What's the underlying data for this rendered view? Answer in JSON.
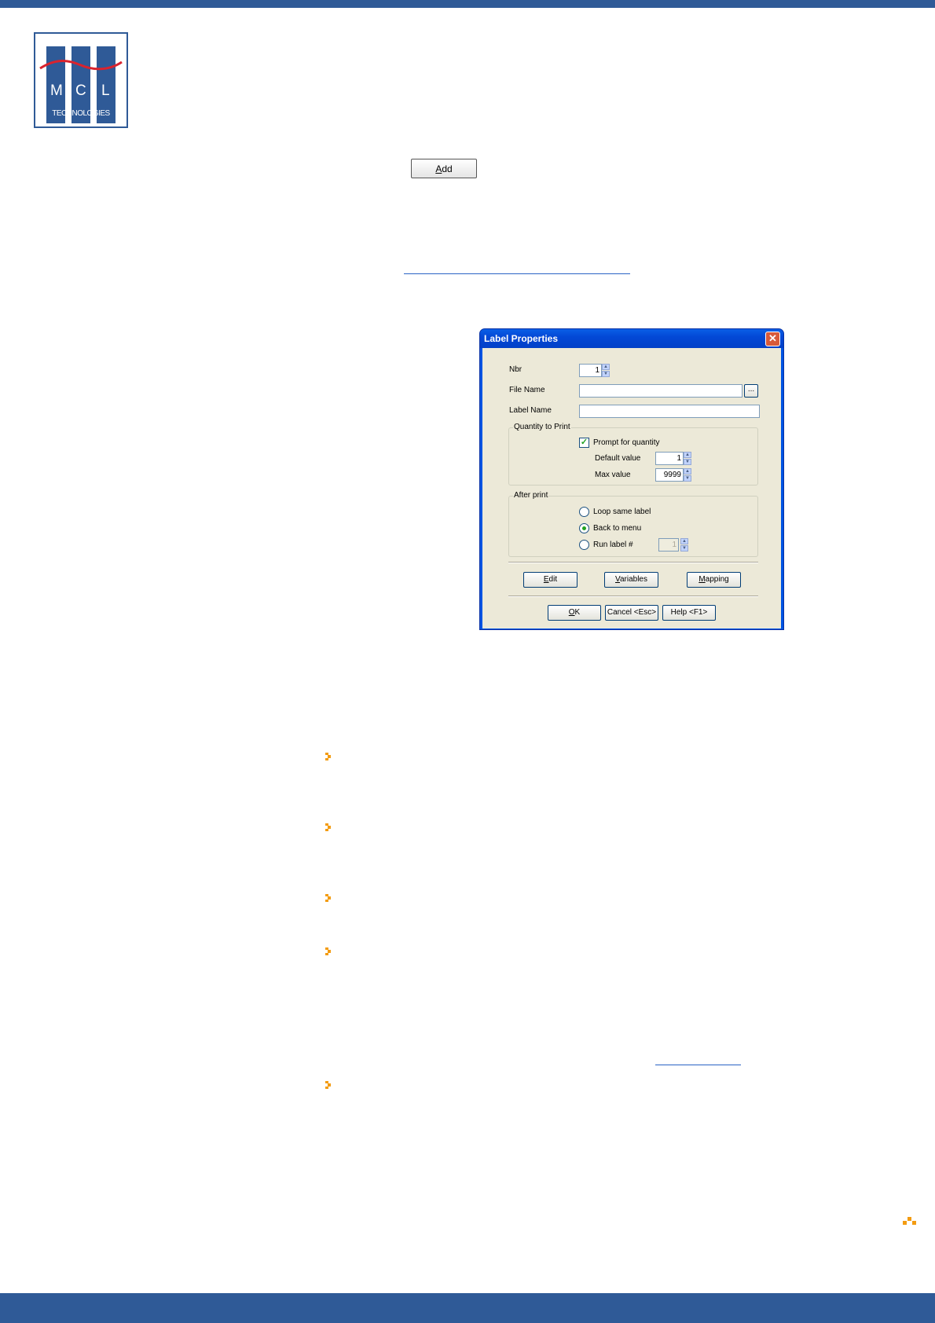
{
  "logo": {
    "letters": [
      "M",
      "C",
      "L"
    ],
    "subtitle": "TECHNOLOGIES",
    "brand_color": "#2f5a97",
    "wave_color": "#d9232e"
  },
  "doc_button": {
    "accel": "A",
    "rest": "dd"
  },
  "dialog": {
    "title": "Label Properties",
    "close_glyph": "✕",
    "nbr": {
      "label": "Nbr",
      "value": "1"
    },
    "file_name": {
      "label": "File Name",
      "value": "",
      "browse": "..."
    },
    "label_name": {
      "label": "Label Name",
      "value": ""
    },
    "quantity": {
      "group_title": "Quantity to Print",
      "prompt_label": "Prompt for quantity",
      "prompt_checked": true,
      "default_label": "Default value",
      "default_value": "1",
      "max_label": "Max value",
      "max_value": "9999"
    },
    "after_print": {
      "group_title": "After print",
      "options": [
        "Loop same label",
        "Back to menu",
        "Run label #"
      ],
      "selected": "Back to menu",
      "run_label_value": "1"
    },
    "buttons": {
      "edit": {
        "accel": "E",
        "rest": "dit"
      },
      "variables": {
        "accel": "V",
        "rest": "ariables"
      },
      "mapping": {
        "accel": "M",
        "rest": "apping"
      },
      "ok": {
        "accel": "O",
        "rest": "K"
      },
      "cancel": "Cancel <Esc>",
      "help": "Help <F1>"
    }
  },
  "colors": {
    "bullet": "#f39c12",
    "link": "#2a63c5",
    "bar": "#2f5a97"
  }
}
